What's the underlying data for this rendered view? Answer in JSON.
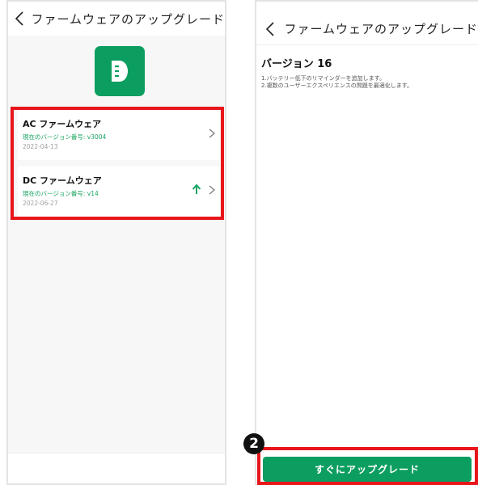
{
  "left_screen": {
    "title": "ファームウェアのアップグレード",
    "firmware": [
      {
        "name": "AC ファームウェア",
        "version": "現在のバージョン番号: v3004",
        "date": "2022-04-13",
        "has_update": false
      },
      {
        "name": "DC ファームウェア",
        "version": "現在のバージョン番号: v14",
        "date": "2022-06-27",
        "has_update": true
      }
    ]
  },
  "right_screen": {
    "title": "ファームウェアのアップグレード",
    "version_title": "バージョン 16",
    "notes": [
      "1.バッテリー低下のリマインダーを追加します。",
      "2.複数のユーザーエクスペリエンスの問題を最適化します。"
    ],
    "upgrade_button": "すぐにアップグレード"
  },
  "annotation": {
    "step_number": "2"
  },
  "colors": {
    "accent": "#0c9e60",
    "version_text": "#19a562",
    "highlight": "#e8161a"
  },
  "icons": [
    "back-icon",
    "app-logo-icon",
    "chevron-right-icon",
    "upgrade-arrow-icon"
  ]
}
